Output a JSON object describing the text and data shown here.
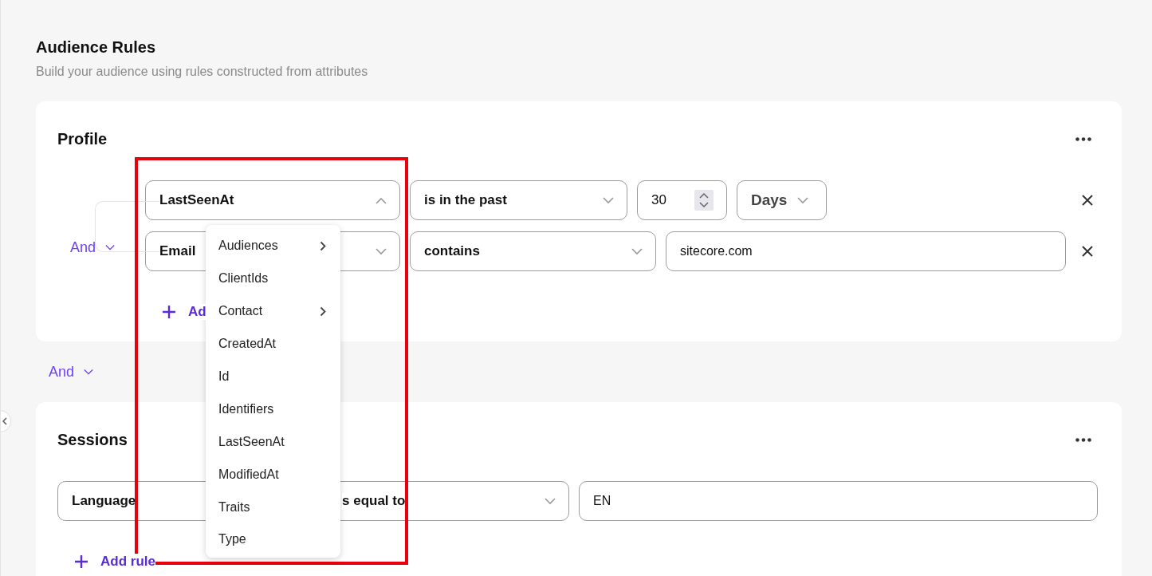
{
  "page": {
    "title": "Audience Rules",
    "subtitle": "Build your audience using rules constructed from attributes"
  },
  "groups": [
    {
      "title": "Profile",
      "connector": "And",
      "add_label": "Ad",
      "rules": [
        {
          "kind": "number",
          "attribute": "LastSeenAt",
          "expanded": true,
          "operator": "is in the past",
          "number": "30",
          "unit": "Days",
          "removable": true
        },
        {
          "kind": "text",
          "attribute": "Email",
          "expanded": false,
          "operator": "contains",
          "value": "sitecore.com",
          "removable": true
        }
      ]
    },
    {
      "title": "Sessions",
      "add_label": "Add rule",
      "rules": [
        {
          "kind": "text",
          "attribute": "Language",
          "operator": "s equal to",
          "value": "EN",
          "removable": false
        }
      ]
    }
  ],
  "group_connector": "And",
  "menu": {
    "items": [
      {
        "label": "Audiences",
        "submenu": true
      },
      {
        "label": "ClientIds",
        "submenu": false
      },
      {
        "label": "Contact",
        "submenu": true
      },
      {
        "label": "CreatedAt",
        "submenu": false
      },
      {
        "label": "Id",
        "submenu": false
      },
      {
        "label": "Identifiers",
        "submenu": false
      },
      {
        "label": "LastSeenAt",
        "submenu": false
      },
      {
        "label": "ModifiedAt",
        "submenu": false
      },
      {
        "label": "Traits",
        "submenu": false
      },
      {
        "label": "Type",
        "submenu": false
      }
    ]
  }
}
